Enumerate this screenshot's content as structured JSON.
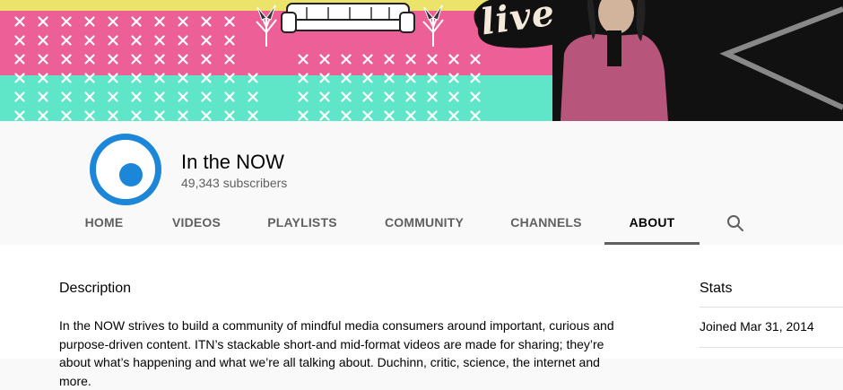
{
  "banner": {
    "colors": {
      "yellow": "#ece36a",
      "pink": "#ec5f97",
      "teal": "#5fe6c8",
      "dark": "#111111"
    },
    "live_text": "live"
  },
  "channel": {
    "name": "In the NOW",
    "subscribers": "49,343 subscribers",
    "avatar_color": "#1c87d8"
  },
  "tabs": [
    {
      "label": "HOME"
    },
    {
      "label": "VIDEOS"
    },
    {
      "label": "PLAYLISTS"
    },
    {
      "label": "COMMUNITY"
    },
    {
      "label": "CHANNELS"
    },
    {
      "label": "ABOUT",
      "active": true
    }
  ],
  "search_icon": "search-icon",
  "about": {
    "description_heading": "Description",
    "description_text": "In the NOW strives to build a community of mindful media consumers around important, curious and purpose-driven content. ITN’s stackable short-and mid-format videos are made for sharing; they’re about what’s happening and what we’re all talking about. Duchinn, critic, science, the internet and more.",
    "stats_heading": "Stats",
    "joined": "Joined Mar 31, 2014"
  }
}
